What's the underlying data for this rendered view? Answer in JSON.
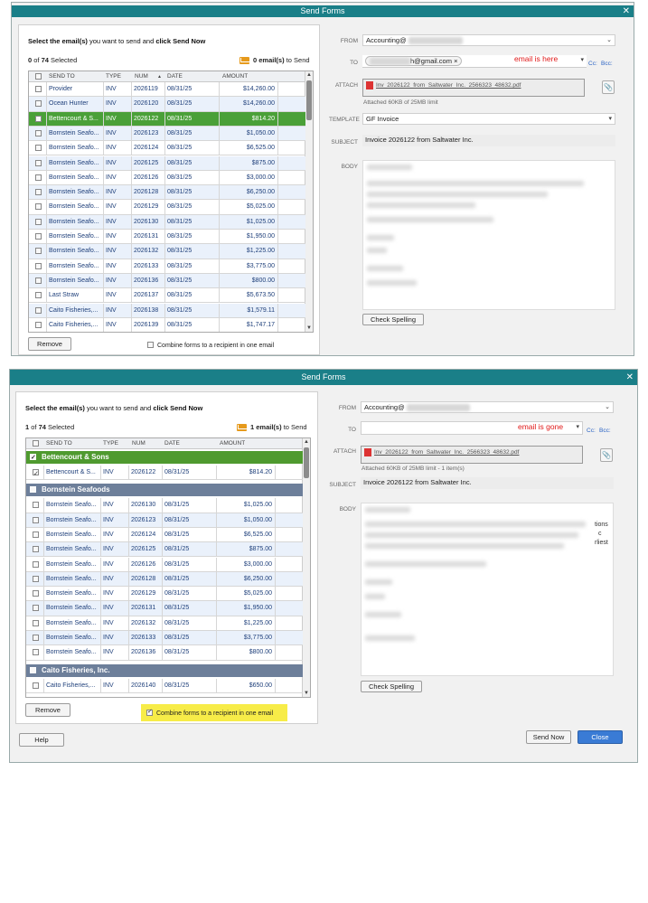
{
  "top": {
    "title": "Send Forms",
    "instruction": {
      "pre": "Select the email(s)",
      "mid": " you want to send and ",
      "bold2": "click Send Now"
    },
    "selected_count": "0",
    "selected_total": "74",
    "selected_suffix": "Selected",
    "to_send": "0 email(s)",
    "to_send_suffix": "to Send",
    "columns": [
      "SEND TO",
      "TYPE",
      "NUM",
      "DATE",
      "AMOUNT"
    ],
    "sort_arrow": "▲",
    "rows": [
      {
        "to": "Provider",
        "type": "INV",
        "num": "2026119",
        "date": "08/31/25",
        "amount": "$14,260.00"
      },
      {
        "to": "Ocean Hunter",
        "type": "INV",
        "num": "2026120",
        "date": "08/31/25",
        "amount": "$14,260.00"
      },
      {
        "to": "Bettencourt & S...",
        "type": "INV",
        "num": "2026122",
        "date": "08/31/25",
        "amount": "$814.20"
      },
      {
        "to": "Bornstein Seafo...",
        "type": "INV",
        "num": "2026123",
        "date": "08/31/25",
        "amount": "$1,050.00"
      },
      {
        "to": "Bornstein Seafo...",
        "type": "INV",
        "num": "2026124",
        "date": "08/31/25",
        "amount": "$6,525.00"
      },
      {
        "to": "Bornstein Seafo...",
        "type": "INV",
        "num": "2026125",
        "date": "08/31/25",
        "amount": "$875.00"
      },
      {
        "to": "Bornstein Seafo...",
        "type": "INV",
        "num": "2026126",
        "date": "08/31/25",
        "amount": "$3,000.00"
      },
      {
        "to": "Bornstein Seafo...",
        "type": "INV",
        "num": "2026128",
        "date": "08/31/25",
        "amount": "$6,250.00"
      },
      {
        "to": "Bornstein Seafo...",
        "type": "INV",
        "num": "2026129",
        "date": "08/31/25",
        "amount": "$5,025.00"
      },
      {
        "to": "Bornstein Seafo...",
        "type": "INV",
        "num": "2026130",
        "date": "08/31/25",
        "amount": "$1,025.00"
      },
      {
        "to": "Bornstein Seafo...",
        "type": "INV",
        "num": "2026131",
        "date": "08/31/25",
        "amount": "$1,950.00"
      },
      {
        "to": "Bornstein Seafo...",
        "type": "INV",
        "num": "2026132",
        "date": "08/31/25",
        "amount": "$1,225.00"
      },
      {
        "to": "Bornstein Seafo...",
        "type": "INV",
        "num": "2026133",
        "date": "08/31/25",
        "amount": "$3,775.00"
      },
      {
        "to": "Bornstein Seafo...",
        "type": "INV",
        "num": "2026136",
        "date": "08/31/25",
        "amount": "$800.00"
      },
      {
        "to": "Last Straw",
        "type": "INV",
        "num": "2026137",
        "date": "08/31/25",
        "amount": "$5,673.50"
      },
      {
        "to": "Caito Fisheries,...",
        "type": "INV",
        "num": "2026138",
        "date": "08/31/25",
        "amount": "$1,579.11"
      },
      {
        "to": "Caito Fisheries,...",
        "type": "INV",
        "num": "2026139",
        "date": "08/31/25",
        "amount": "$1,747.17"
      }
    ],
    "remove": "Remove",
    "combine": "Combine forms to a recipient in one email",
    "labels": {
      "from": "FROM",
      "to": "TO",
      "attach": "ATTACH",
      "template": "TEMPLATE",
      "subject": "SUBJECT",
      "body": "BODY"
    },
    "from": "Accounting@",
    "to": "h@gmail.com",
    "to_remove": "×",
    "annotation": "email is here",
    "cc": "Cc:",
    "bcc": "Bcc:",
    "attachment": "Inv_2026122_from_Saltwater_Inc._2566323_48632.pdf",
    "attach_note": "Attached 60KB of 25MB limit",
    "template": "GF Invoice",
    "subject": "Invoice 2026122 from Saltwater Inc.",
    "check_spelling": "Check Spelling"
  },
  "bottom": {
    "title": "Send Forms",
    "instruction": {
      "pre": "Select the email(s)",
      "mid": " you want to send and ",
      "bold2": "click Send Now"
    },
    "selected_count": "1",
    "selected_total": "74",
    "selected_suffix": "Selected",
    "to_send": "1 email(s)",
    "to_send_suffix": "to Send",
    "columns": [
      "SEND TO",
      "TYPE",
      "NUM",
      "DATE",
      "AMOUNT"
    ],
    "groups": [
      {
        "name": "Bettencourt & Sons",
        "color": "#4f9a2f",
        "rows": [
          {
            "to": "Bettencourt & S...",
            "type": "INV",
            "num": "2026122",
            "date": "08/31/25",
            "amount": "$814.20"
          }
        ]
      },
      {
        "name": "Bornstein Seafoods",
        "color": "#6d7f9a",
        "rows": [
          {
            "to": "Bornstein Seafo...",
            "type": "INV",
            "num": "2026130",
            "date": "08/31/25",
            "amount": "$1,025.00"
          },
          {
            "to": "Bornstein Seafo...",
            "type": "INV",
            "num": "2026123",
            "date": "08/31/25",
            "amount": "$1,050.00"
          },
          {
            "to": "Bornstein Seafo...",
            "type": "INV",
            "num": "2026124",
            "date": "08/31/25",
            "amount": "$6,525.00"
          },
          {
            "to": "Bornstein Seafo...",
            "type": "INV",
            "num": "2026125",
            "date": "08/31/25",
            "amount": "$875.00"
          },
          {
            "to": "Bornstein Seafo...",
            "type": "INV",
            "num": "2026126",
            "date": "08/31/25",
            "amount": "$3,000.00"
          },
          {
            "to": "Bornstein Seafo...",
            "type": "INV",
            "num": "2026128",
            "date": "08/31/25",
            "amount": "$6,250.00"
          },
          {
            "to": "Bornstein Seafo...",
            "type": "INV",
            "num": "2026129",
            "date": "08/31/25",
            "amount": "$5,025.00"
          },
          {
            "to": "Bornstein Seafo...",
            "type": "INV",
            "num": "2026131",
            "date": "08/31/25",
            "amount": "$1,950.00"
          },
          {
            "to": "Bornstein Seafo...",
            "type": "INV",
            "num": "2026132",
            "date": "08/31/25",
            "amount": "$1,225.00"
          },
          {
            "to": "Bornstein Seafo...",
            "type": "INV",
            "num": "2026133",
            "date": "08/31/25",
            "amount": "$3,775.00"
          },
          {
            "to": "Bornstein Seafo...",
            "type": "INV",
            "num": "2026136",
            "date": "08/31/25",
            "amount": "$800.00"
          }
        ]
      },
      {
        "name": "Caito Fisheries, Inc.",
        "color": "#6d7f9a",
        "rows": [
          {
            "to": "Caito Fisheries,...",
            "type": "INV",
            "num": "2026140",
            "date": "08/31/25",
            "amount": "$650.00"
          }
        ]
      }
    ],
    "remove": "Remove",
    "combine": "Combine forms to a recipient in one email",
    "labels": {
      "from": "FROM",
      "to": "TO",
      "attach": "ATTACH",
      "subject": "SUBJECT",
      "body": "BODY"
    },
    "from": "Accounting@",
    "annotation": "email is gone",
    "cc": "Cc:",
    "bcc": "Bcc:",
    "attachment": "Inv_2026122_from_Saltwater_Inc._2566323_48632.pdf",
    "attach_note": "Attached 60KB of 25MB limit - 1 item(s)",
    "subject": "Invoice 2026122 from Saltwater Inc.",
    "body_fragments": [
      "tions",
      "c",
      "rliest"
    ],
    "check_spelling": "Check Spelling",
    "help": "Help",
    "send_now": "Send Now",
    "close": "Close"
  }
}
